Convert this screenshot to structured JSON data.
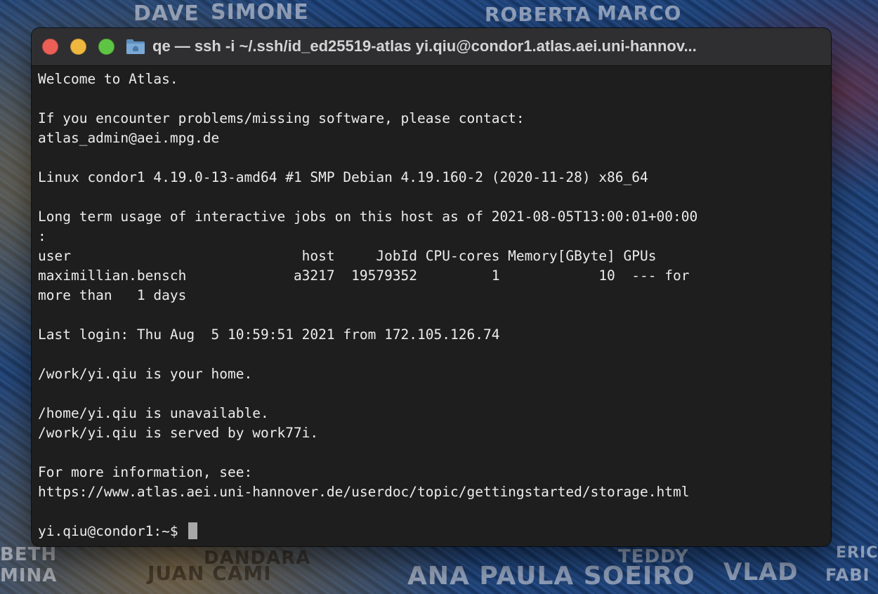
{
  "window": {
    "title": "qe — ssh -i ~/.ssh/id_ed25519-atlas yi.qiu@condor1.atlas.aei.uni-hannov...",
    "folder_icon": "folder-icon"
  },
  "terminal": {
    "lines": [
      "Welcome to Atlas.",
      "",
      "If you encounter problems/missing software, please contact:",
      "atlas_admin@aei.mpg.de",
      "",
      "Linux condor1 4.19.0-13-amd64 #1 SMP Debian 4.19.160-2 (2020-11-28) x86_64",
      "",
      "Long term usage of interactive jobs on this host as of 2021-08-05T13:00:01+00:00",
      ":",
      "user                            host     JobId CPU-cores Memory[GByte] GPUs",
      "maximillian.bensch             a3217  19579352         1            10  --- for",
      "more than   1 days",
      "",
      "Last login: Thu Aug  5 10:59:51 2021 from 172.105.126.74",
      "",
      "/work/yi.qiu is your home.",
      "",
      "/home/yi.qiu is unavailable.",
      "/work/yi.qiu is served by work77i.",
      "",
      "For more information, see:",
      "https://www.atlas.aei.uni-hannover.de/userdoc/topic/gettingstarted/storage.html",
      ""
    ],
    "prompt": "yi.qiu@condor1:~$ "
  },
  "background": {
    "wall_texts": [
      "DAVE",
      "SIMONE",
      "ROBERTA",
      "MARCO",
      "JUAN CAMI",
      "DANDARA",
      "ANA PAULA SOEIRO",
      "VLAD",
      "FABI",
      "ERIC",
      "MINA",
      "BETH",
      "TEDDY"
    ]
  }
}
